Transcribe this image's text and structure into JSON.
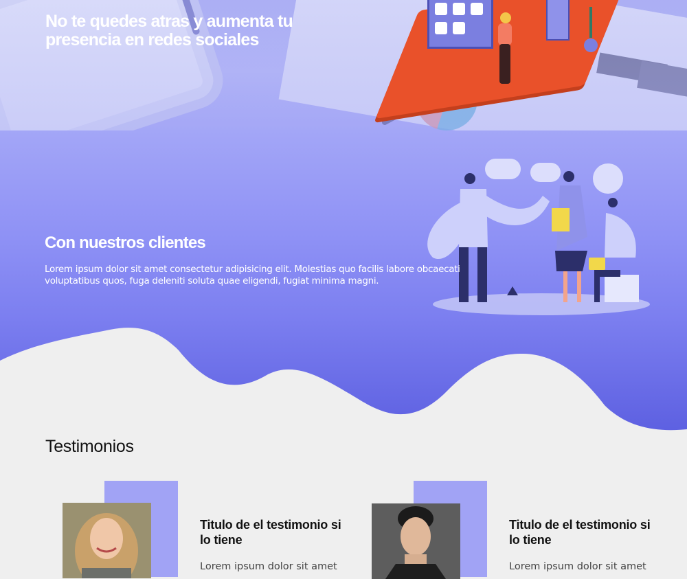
{
  "hero": {
    "title": "No te quedes atras y aumenta tu presencia en redes sociales"
  },
  "clients": {
    "title": "Con nuestros clientes",
    "text": "Lorem ipsum dolor sit amet consectetur adipisicing elit. Molestias quo facilis labore obcaecati voluptatibus quos, fuga deleniti soluta quae eligendi, fugiat minima magni."
  },
  "testimonials": {
    "heading": "Testimonios",
    "items": [
      {
        "title": "Titulo de el testimonio si lo tiene",
        "text": "Lorem ipsum dolor sit amet"
      },
      {
        "title": "Titulo de el testimonio si lo tiene",
        "text": "Lorem ipsum dolor sit amet"
      }
    ]
  },
  "colors": {
    "accent": "#a1a3f5",
    "band_top": "#a3a6f7",
    "band_bottom": "#5b5ee0",
    "background": "#efefef"
  }
}
